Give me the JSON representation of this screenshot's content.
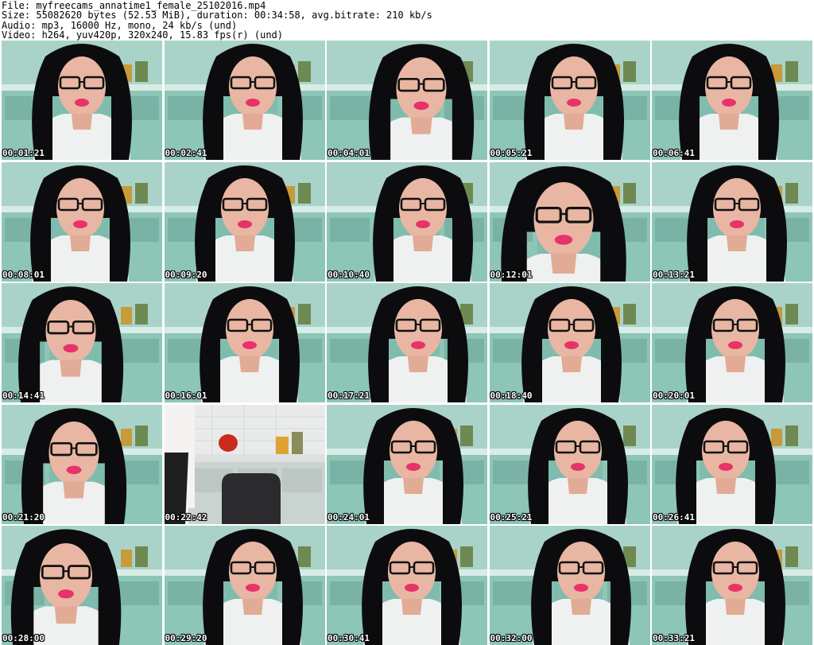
{
  "header": {
    "file_line": "File: myfreecams_annatime1_female_25102016.mp4",
    "size_line": "Size: 55082620 bytes (52.53 MiB), duration: 00:34:58, avg.bitrate: 210 kb/s",
    "audio_line": "Audio: mp3, 16000 Hz, mono, 24 kb/s (und)",
    "video_line": "Video: h264, yuv420p, 320x240, 15.83 fps(r) (und)"
  },
  "frames": [
    {
      "ts": "00:01:21",
      "scene": "person"
    },
    {
      "ts": "00:02:41",
      "scene": "person"
    },
    {
      "ts": "00:04:01",
      "scene": "person"
    },
    {
      "ts": "00:05:21",
      "scene": "person"
    },
    {
      "ts": "00:06:41",
      "scene": "person"
    },
    {
      "ts": "00:08:01",
      "scene": "person"
    },
    {
      "ts": "00:09:20",
      "scene": "person"
    },
    {
      "ts": "00:10:40",
      "scene": "person"
    },
    {
      "ts": "00:12:01",
      "scene": "person"
    },
    {
      "ts": "00:13:21",
      "scene": "person"
    },
    {
      "ts": "00:14:41",
      "scene": "person"
    },
    {
      "ts": "00:16:01",
      "scene": "person"
    },
    {
      "ts": "00:17:21",
      "scene": "person"
    },
    {
      "ts": "00:18:40",
      "scene": "person"
    },
    {
      "ts": "00:20:01",
      "scene": "person"
    },
    {
      "ts": "00:21:20",
      "scene": "person"
    },
    {
      "ts": "00:22:42",
      "scene": "empty-kitchen"
    },
    {
      "ts": "00:24:01",
      "scene": "person"
    },
    {
      "ts": "00:25:21",
      "scene": "person"
    },
    {
      "ts": "00:26:41",
      "scene": "person"
    },
    {
      "ts": "00:28:00",
      "scene": "person"
    },
    {
      "ts": "00:29:20",
      "scene": "person"
    },
    {
      "ts": "00:30:41",
      "scene": "person"
    },
    {
      "ts": "00:32:00",
      "scene": "person"
    },
    {
      "ts": "00:33:21",
      "scene": "person"
    }
  ],
  "colors": {
    "background": "#ffffff",
    "kitchen_wall": "#79b6a6",
    "cabinet": "#9ccdbf",
    "hair": "#0c0c0e",
    "skin": "#e8b6a2",
    "shirt": "#eef1f0",
    "lips": "#e8326a",
    "timestamp_text": "#ffffff"
  }
}
